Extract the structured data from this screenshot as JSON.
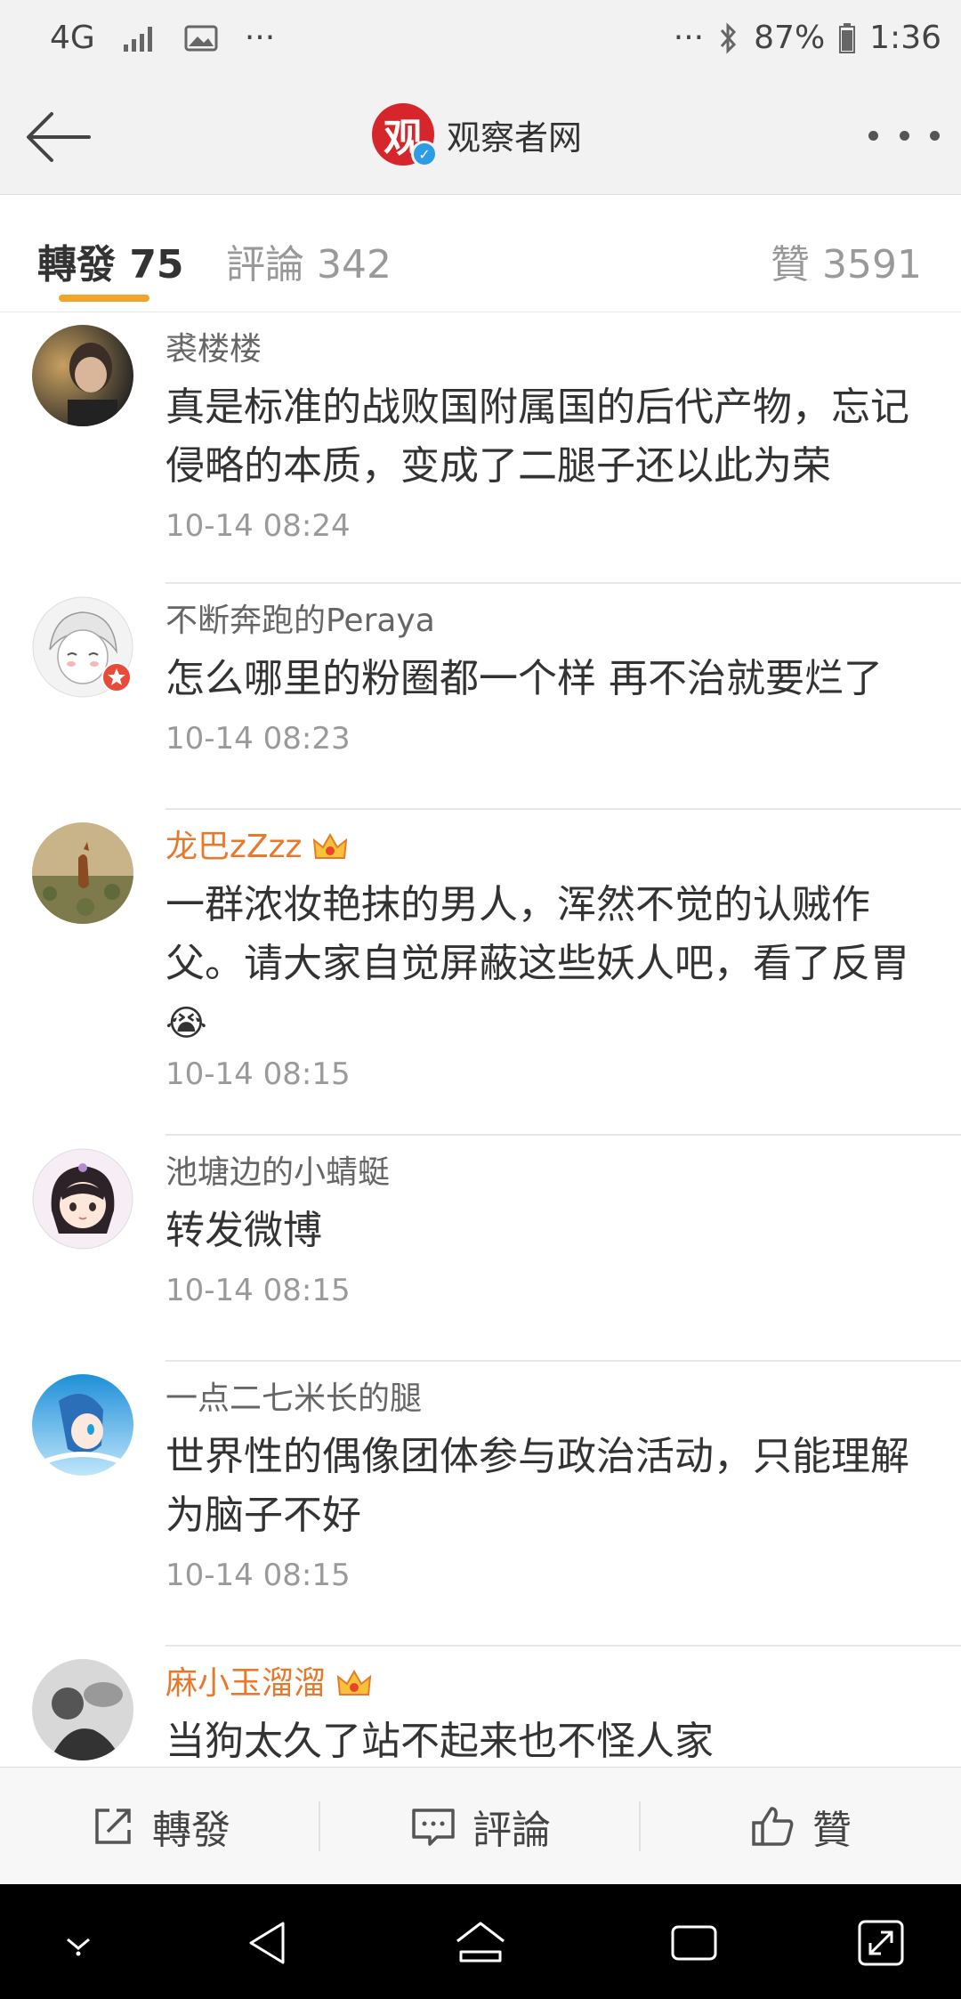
{
  "status_bar": {
    "network": "4G",
    "more": "···",
    "more_right": "···",
    "battery": "87%",
    "time": "1:36"
  },
  "header": {
    "logo_char": "观",
    "title": "观察者网"
  },
  "tabs": {
    "repost": "轉發 75",
    "comment": "評論 342",
    "like": "贊 3591"
  },
  "reposts": [
    {
      "name": "裘楼楼",
      "text": "真是标准的战败国附属国的后代产物，忘记侵略的本质，变成了二腿子还以此为荣",
      "time": "10-14 08:24"
    },
    {
      "name": "不断奔跑的Peraya",
      "text": "怎么哪里的粉圈都一个样 再不治就要烂了",
      "time": "10-14 08:23"
    },
    {
      "name": "龙巴zZzz",
      "text": "一群浓妆艳抹的男人，浑然不觉的认贼作父。请大家自觉屏蔽这些妖人吧，看了反胃",
      "emoji": "😭",
      "time": "10-14 08:15"
    },
    {
      "name": "池塘边的小蜻蜓",
      "text": "转发微博",
      "time": "10-14 08:15"
    },
    {
      "name": "一点二七米长的腿",
      "text": "世界性的偶像团体参与政治活动，只能理解为脑子不好",
      "time": "10-14 08:15"
    },
    {
      "name": "麻小玉溜溜",
      "text": "当狗太久了站不起来也不怪人家",
      "time": ""
    }
  ],
  "bottom_bar": {
    "repost": "轉發",
    "comment": "評論",
    "like": "贊"
  },
  "colors": {
    "accent": "#f2a42b",
    "vip_name": "#e8792b",
    "brand": "#d7262b",
    "verified": "#2c9ce7"
  }
}
